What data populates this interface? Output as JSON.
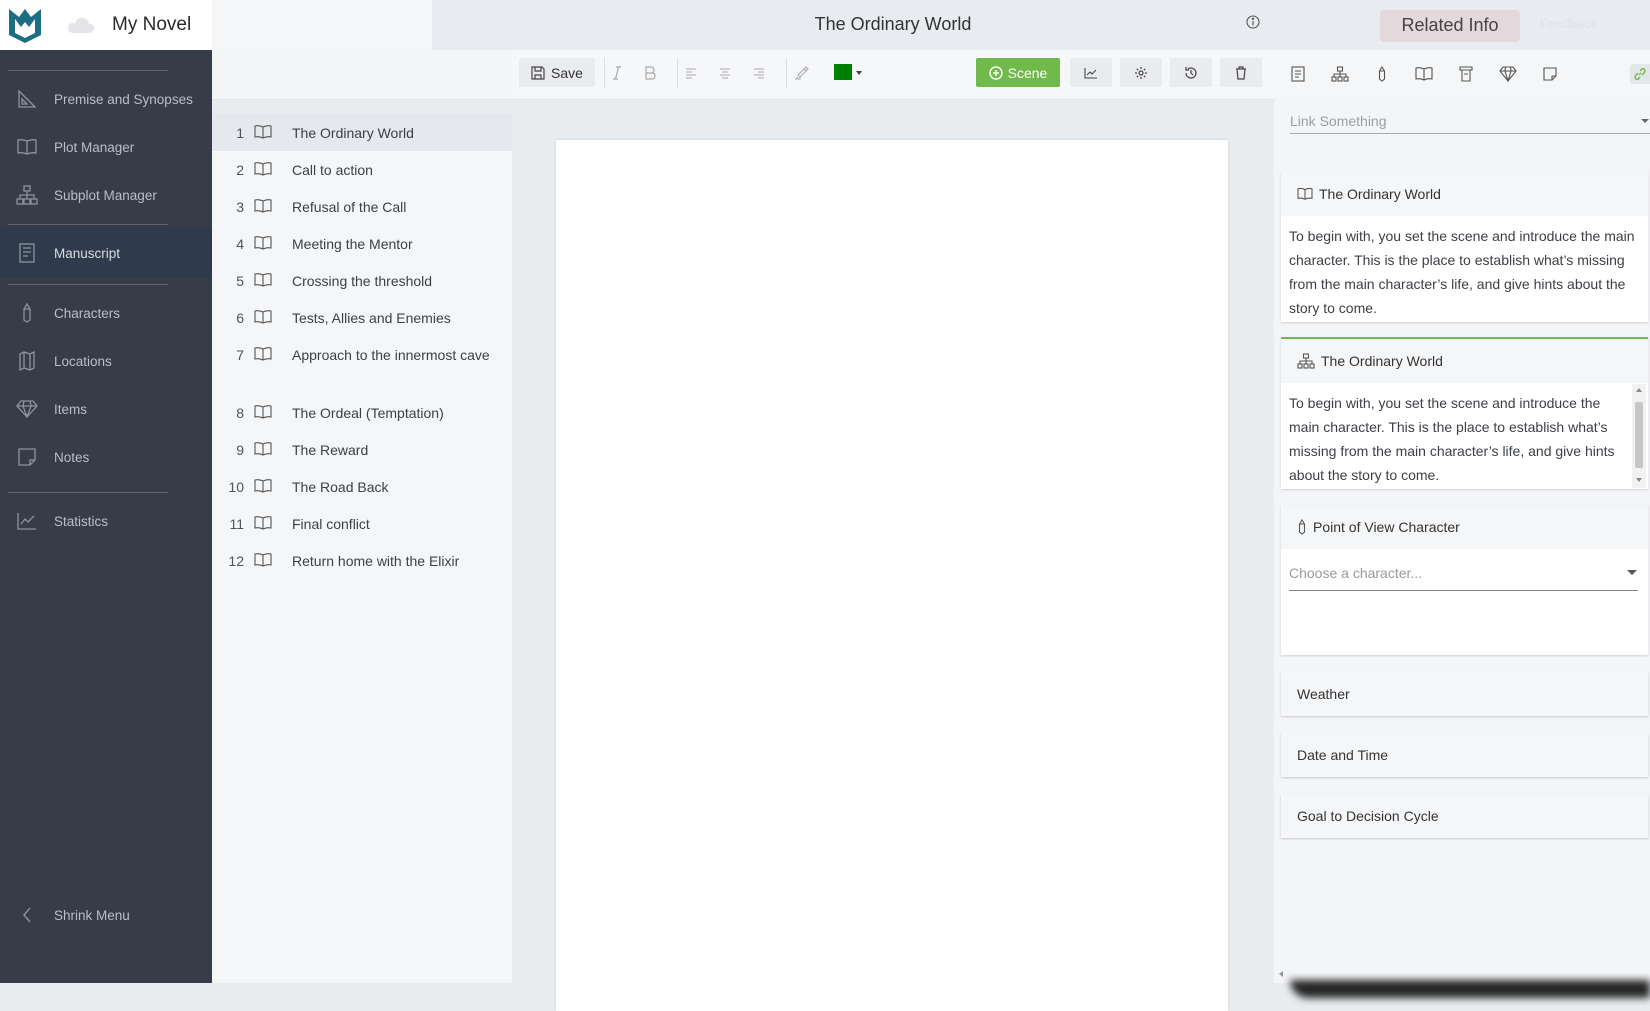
{
  "app": {
    "novel_title": "My Novel",
    "document_title": "The Ordinary World"
  },
  "sidebar": {
    "items": [
      {
        "label": "Premise and Synopses",
        "icon": "ruler-triangle-icon"
      },
      {
        "label": "Plot Manager",
        "icon": "open-book-icon"
      },
      {
        "label": "Subplot Manager",
        "icon": "hierarchy-icon"
      },
      {
        "label": "Manuscript",
        "icon": "manuscript-icon",
        "active": true
      },
      {
        "label": "Characters",
        "icon": "pen-icon"
      },
      {
        "label": "Locations",
        "icon": "map-icon"
      },
      {
        "label": "Items",
        "icon": "diamond-icon"
      },
      {
        "label": "Notes",
        "icon": "note-icon"
      },
      {
        "label": "Statistics",
        "icon": "chart-icon"
      }
    ],
    "shrink_label": "Shrink Menu"
  },
  "chapters": [
    {
      "num": "1",
      "title": "The Ordinary World",
      "active": true
    },
    {
      "num": "2",
      "title": "Call to action"
    },
    {
      "num": "3",
      "title": "Refusal of the Call"
    },
    {
      "num": "4",
      "title": "Meeting the Mentor"
    },
    {
      "num": "5",
      "title": "Crossing the threshold"
    },
    {
      "num": "6",
      "title": "Tests, Allies and Enemies"
    },
    {
      "num": "7",
      "title": "Approach to the innermost cave"
    },
    {
      "num": "8",
      "title": "The Ordeal (Temptation)"
    },
    {
      "num": "9",
      "title": "The Reward"
    },
    {
      "num": "10",
      "title": "The Road Back"
    },
    {
      "num": "11",
      "title": "Final conflict"
    },
    {
      "num": "12",
      "title": "Return home with the Elixir"
    }
  ],
  "toolbar": {
    "save_label": "Save",
    "scene_label": "Scene",
    "text_color": "#008000",
    "scene_color": "#6fba4a"
  },
  "right_panel": {
    "tab_label": "Related Info",
    "feedback_label": "Feedback",
    "link_placeholder": "Link Something",
    "plot_card": {
      "title": "The Ordinary World",
      "text": "To begin with, you set the scene and introduce the main character. This is the place to establish what’s missing from the main character’s life, and give hints about the story to come."
    },
    "subplot_card": {
      "title": "The Ordinary World",
      "text": "To begin with, you set the scene and introduce the main character. This is the place to establish what’s missing from the main character’s life, and give hints about the story to come."
    },
    "pov_card": {
      "title": "Point of View Character",
      "placeholder": "Choose a character..."
    },
    "weather_label": "Weather",
    "datetime_label": "Date and Time",
    "goal_label": "Goal to Decision Cycle",
    "accent_color": "#6fba4a"
  }
}
